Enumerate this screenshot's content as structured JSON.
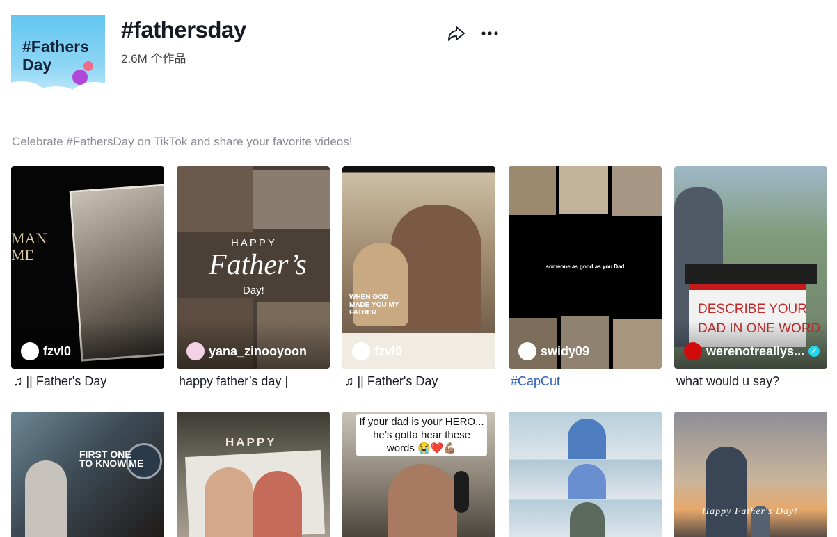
{
  "header": {
    "cover_text": "#Fathers\nDay",
    "title": "#fathersday",
    "count": "2.6M 个作品",
    "share_icon": "share-arrow-icon",
    "more_icon": "more-horizontal-icon"
  },
  "description": "Celebrate #FathersDay on TikTok and share your favorite videos!",
  "colors": {
    "hashtag_link": "#2b5db9",
    "verified_badge": "#20d5ec",
    "subtle_text": "#8a8b91"
  },
  "videos": [
    {
      "author": "fzvl0",
      "caption": "♫ || Father's Day",
      "overlay": "MAN\nME"
    },
    {
      "author": "yana_zinooyoon",
      "caption": "happy father’s day |",
      "overlay_top": "HAPPY",
      "overlay_main": "Father’s",
      "overlay_bottom": "Day!"
    },
    {
      "author": "fzvl0",
      "caption": "♫ || Father's Day",
      "overlay": "WHEN GOD\nMADE YOU MY\nFATHER"
    },
    {
      "author": "swidy09",
      "caption": "#CapCut",
      "overlay": "someone as good as you  Dad"
    },
    {
      "author": "werenotreallys...",
      "caption": "what would u say?",
      "overlay": "DESCRIBE YOUR\nDAD IN ONE WORD.",
      "verified": true
    },
    {
      "overlay": "FIRST ONE\nTO KNOW ME"
    },
    {
      "overlay": "HAPPY"
    },
    {
      "overlay": "If your dad is your HERO... he’s gotta hear these words 😭❤️💪🏽"
    },
    {
      "overlay": ""
    },
    {
      "overlay": "Happy Father's Day!"
    }
  ]
}
